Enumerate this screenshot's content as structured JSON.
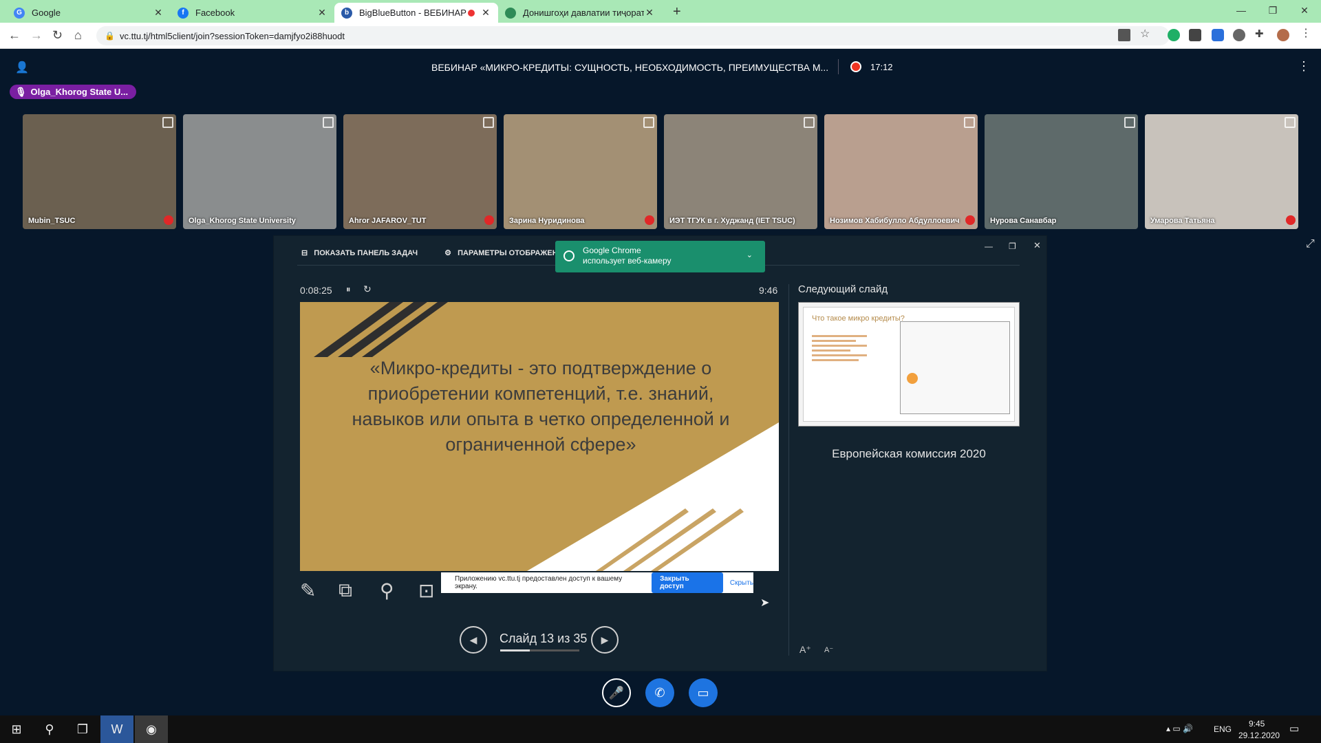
{
  "browser": {
    "tabs": [
      {
        "title": "Google",
        "icon": "google-icon",
        "color": "#4285f4"
      },
      {
        "title": "Facebook",
        "icon": "facebook-icon",
        "color": "#1877f2"
      },
      {
        "title": "BigBlueButton - ВЕБИНАР «",
        "icon": "bigbluebutton-icon",
        "color": "#2a5aa8"
      },
      {
        "title": "Донишгоҳи давлатии тиҷорати",
        "icon": "site-icon",
        "color": "#2e8b57"
      }
    ],
    "url": "vc.ttu.tj/html5client/join?sessionToken=damjfyo2i88huodt"
  },
  "meeting": {
    "title": "ВЕБИНАР «МИКРО-КРЕДИТЫ: СУЩНОСТЬ, НЕОБХОДИМОСТЬ, ПРЕИМУЩЕСТВА М...",
    "record_time": "17:12",
    "talking": "Olga_Khorog State U..."
  },
  "videos": [
    {
      "name": "Mubin_TSUC",
      "bg": "#6b6050"
    },
    {
      "name": "Olga_Khorog State University",
      "bg": "#8a8d8e"
    },
    {
      "name": "Ahror JAFAROV_TUT",
      "bg": "#7d6c5a"
    },
    {
      "name": "Зарина Нуридинова",
      "bg": "#a39074"
    },
    {
      "name": "ИЭТ ТГУК в г. Худжанд (IET TSUC)",
      "bg": "#8c8478"
    },
    {
      "name": "Нозимов Хабибулло Абдуллоевич",
      "bg": "#b99f8f"
    },
    {
      "name": "Нурова Санавбар",
      "bg": "#5e6a6a"
    },
    {
      "name": "Умарова Татьяна",
      "bg": "#c8c2bb"
    }
  ],
  "presenter": {
    "show_taskbar": "ПОКАЗАТЬ ПАНЕЛЬ ЗАДАЧ",
    "display_settings": "ПАРАМЕТРЫ ОТОБРАЖЕНИЯ ▾",
    "elapsed": "0:08:25",
    "clock": "9:46",
    "next_slide_label": "Следующий слайд",
    "next_slide_title": "Что такое микро кредиты?",
    "next_slide_caption": "Европейская комиссия 2020",
    "slide_text": "«Микро-кредиты - это подтверждение о приобретении компетенций, т.е. знаний, навыков или опыта в четко определенной и ограниченной сфере»",
    "slide_counter": "Слайд 13 из 35",
    "progress": 0.37
  },
  "chrome_notice": {
    "line1": "Google Chrome",
    "line2": "использует веб-камеру"
  },
  "share_bar": {
    "text": "Приложению vc.ttu.tj предоставлен доступ к вашему экрану.",
    "stop": "Закрыть доступ",
    "hide": "Скрыть"
  },
  "taskbar": {
    "lang": "ENG",
    "time": "9:45",
    "date": "29.12.2020"
  }
}
